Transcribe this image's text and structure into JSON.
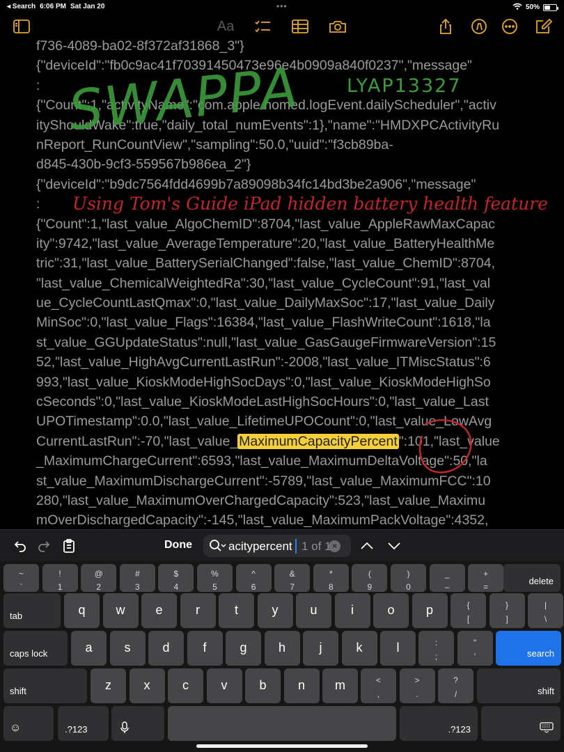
{
  "status_bar": {
    "back_label": "◂ Search",
    "time": "6:06 PM",
    "date": "Sat Jan 20",
    "battery_text": "50%",
    "battery_level": 0.5
  },
  "toolbar": {
    "format_label": "Aa"
  },
  "note": {
    "lines": [
      "f736-4089-ba02-8f372af31868_3\"}",
      "{\"deviceId\":\"fb0c9ac41f70391450473e96e4b0909a840f0237\",\"message\"",
      ":",
      "{\"Count\":1,\"activityName\":\"com.apple.homed.logEvent.dailyScheduler\",\"activ",
      "ityShouldWake\":true,\"daily_total_numEvents\":1},\"name\":\"HMDXPCActivityRu",
      "nReport_RunCountView\",\"sampling\":50.0,\"uuid\":\"f3cb89ba-",
      "d845-430b-9cf3-559567b986ea_2\"}",
      "{\"deviceId\":\"b9dc7564fdd4699b7a89098b34fc14bd3be2a906\",\"message\"",
      ":",
      "{\"Count\":1,\"last_value_AlgoChemID\":8704,\"last_value_AppleRawMaxCapac",
      "ity\":9742,\"last_value_AverageTemperature\":20,\"last_value_BatteryHealthMe",
      "tric\":31,\"last_value_BatterySerialChanged\":false,\"last_value_ChemID\":8704,",
      "\"last_value_ChemicalWeightedRa\":30,\"last_value_CycleCount\":91,\"last_val",
      "ue_CycleCountLastQmax\":0,\"last_value_DailyMaxSoc\":17,\"last_value_Daily",
      "MinSoc\":0,\"last_value_Flags\":16384,\"last_value_FlashWriteCount\":1618,\"la",
      "st_value_GGUpdateStatus\":null,\"last_value_GasGaugeFirmwareVersion\":15",
      "52,\"last_value_HighAvgCurrentLastRun\":-2008,\"last_value_ITMiscStatus\":6",
      "993,\"last_value_KioskModeHighSocDays\":0,\"last_value_KioskModeHighSo",
      "cSeconds\":0,\"last_value_KioskModeLastHighSocHours\":0,\"last_value_Last",
      "UPOTimestamp\":0.0,\"last_value_LifetimeUPOCount\":0,\"last_value_LowAvg"
    ],
    "hl_line_before": "CurrentLastRun\":-70,\"last_value_",
    "hl_match": "MaximumCapacityPercent",
    "hl_line_after": "\":101,\"last_value",
    "lines_after": [
      "_MaximumChargeCurrent\":6593,\"last_value_MaximumDeltaVoltage\":50,\"la",
      "st_value_MaximumDischargeCurrent\":-5789,\"last_value_MaximumFCC\":10",
      "280,\"last_value_MaximumOverChargedCapacity\":523,\"last_value_Maximu",
      "mOverDischargedCapacity\":-145,\"last_value_MaximumPackVoltage\":4352,"
    ]
  },
  "handwriting": {
    "title": "SWAPPA",
    "code": "LYAP13327",
    "caption": "Using Tom's Guide  iPad hidden battery health feature"
  },
  "find_bar": {
    "done_label": "Done",
    "query": "acitypercent",
    "match_count": "1 of 1"
  },
  "keyboard": {
    "row1": [
      {
        "top": "~",
        "bot": "`"
      },
      {
        "top": "!",
        "bot": "1"
      },
      {
        "top": "@",
        "bot": "2"
      },
      {
        "top": "#",
        "bot": "3"
      },
      {
        "top": "$",
        "bot": "4"
      },
      {
        "top": "%",
        "bot": "5"
      },
      {
        "top": "^",
        "bot": "6"
      },
      {
        "top": "&",
        "bot": "7"
      },
      {
        "top": "*",
        "bot": "8"
      },
      {
        "top": "(",
        "bot": "9"
      },
      {
        "top": ")",
        "bot": "0"
      },
      {
        "top": "_",
        "bot": "–"
      },
      {
        "top": "+",
        "bot": "="
      }
    ],
    "delete_label": "delete",
    "tab_label": "tab",
    "row2": [
      "q",
      "w",
      "e",
      "r",
      "t",
      "y",
      "u",
      "i",
      "o",
      "p"
    ],
    "row2_sym": [
      {
        "top": "{",
        "bot": "["
      },
      {
        "top": "}",
        "bot": "]"
      },
      {
        "top": "|",
        "bot": "\\"
      }
    ],
    "caps_label": "caps lock",
    "row3": [
      "a",
      "s",
      "d",
      "f",
      "g",
      "h",
      "j",
      "k",
      "l"
    ],
    "row3_sym": [
      {
        "top": ":",
        "bot": ";"
      },
      {
        "top": "\"",
        "bot": "'"
      }
    ],
    "search_label": "search",
    "shift_label": "shift",
    "row4": [
      "z",
      "x",
      "c",
      "v",
      "b",
      "n",
      "m"
    ],
    "row4_sym": [
      {
        "top": "<",
        "bot": ","
      },
      {
        "top": ">",
        "bot": "."
      },
      {
        "top": "?",
        "bot": "/"
      }
    ],
    "numbers_label": ".?123"
  },
  "colors": {
    "accent": "#e5a82c",
    "highlight": "#f5cf3b",
    "search_key": "#1f72e8",
    "ink_green": "#3c9c3c",
    "ink_red": "#c0262e"
  }
}
